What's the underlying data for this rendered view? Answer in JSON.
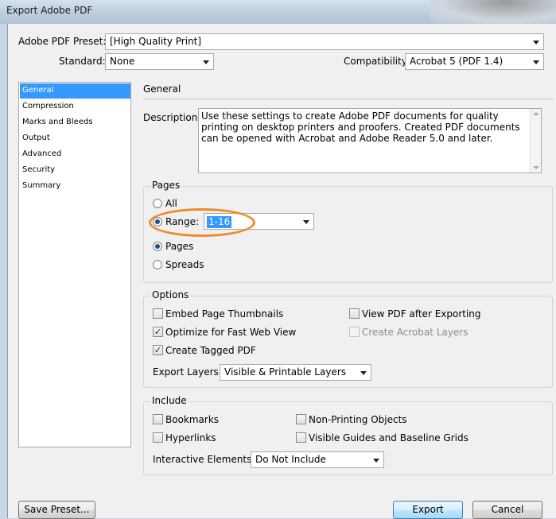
{
  "window": {
    "title": "Export Adobe PDF"
  },
  "preset": {
    "label": "Adobe PDF Preset:",
    "value": "[High Quality Print]"
  },
  "standard": {
    "label": "Standard:",
    "value": "None"
  },
  "compatibility": {
    "label": "Compatibility:",
    "value": "Acrobat 5 (PDF 1.4)"
  },
  "sidebar": {
    "items": [
      {
        "label": "General",
        "selected": true
      },
      {
        "label": "Compression"
      },
      {
        "label": "Marks and Bleeds"
      },
      {
        "label": "Output"
      },
      {
        "label": "Advanced"
      },
      {
        "label": "Security"
      },
      {
        "label": "Summary"
      }
    ]
  },
  "general": {
    "title": "General",
    "description_label": "Description:",
    "description_text": "Use these settings to create Adobe PDF documents for quality printing on desktop printers and proofers.  Created PDF documents can be opened with Acrobat and Adobe Reader 5.0 and later."
  },
  "pages": {
    "title": "Pages",
    "all_label": "All",
    "range_label": "Range:",
    "range_value": "1-16",
    "pages_label": "Pages",
    "spreads_label": "Spreads",
    "selected_scope": "range",
    "selected_layout": "pages"
  },
  "options": {
    "title": "Options",
    "embed_thumbnails": "Embed Page Thumbnails",
    "optimize_web": "Optimize for Fast Web View",
    "create_tagged": "Create Tagged PDF",
    "view_after": "View PDF after Exporting",
    "create_layers": "Create Acrobat Layers",
    "export_layers_label": "Export Layers:",
    "export_layers_value": "Visible & Printable Layers",
    "check_mark": "✓"
  },
  "include": {
    "title": "Include",
    "bookmarks": "Bookmarks",
    "hyperlinks": "Hyperlinks",
    "non_printing": "Non-Printing Objects",
    "visible_guides": "Visible Guides and Baseline Grids",
    "interactive_label": "Interactive Elements:",
    "interactive_value": "Do Not Include"
  },
  "buttons": {
    "save_preset": "Save Preset...",
    "export": "Export",
    "cancel": "Cancel"
  },
  "colors": {
    "selection": "#3399ff",
    "highlight_ring": "#f08a26"
  }
}
